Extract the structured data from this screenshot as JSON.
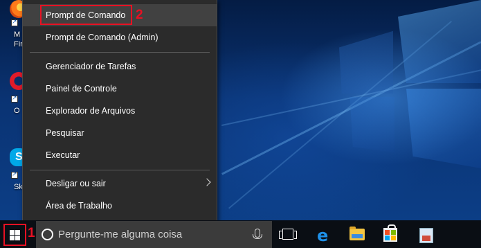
{
  "desktop": {
    "icons": [
      {
        "name": "firefox",
        "label_line1": "M",
        "label_line2": "Fir"
      },
      {
        "name": "opera",
        "label_line1": "O"
      },
      {
        "name": "skype",
        "label_line1": "Sk"
      }
    ]
  },
  "context_menu": {
    "items": [
      {
        "label": "Prompt de Comando"
      },
      {
        "label": "Prompt de Comando (Admin)"
      },
      {
        "label": "Gerenciador de Tarefas"
      },
      {
        "label": "Painel de Controle"
      },
      {
        "label": "Explorador de Arquivos"
      },
      {
        "label": "Pesquisar"
      },
      {
        "label": "Executar"
      },
      {
        "label": "Desligar ou sair"
      },
      {
        "label": "Área de Trabalho"
      }
    ],
    "highlighted_item": "Prompt de Comando"
  },
  "annotations": {
    "step1": "1",
    "step2": "2",
    "color": "#e81123"
  },
  "taskbar": {
    "search_placeholder": "Pergunte-me alguma coisa",
    "pinned_apps": [
      "task-view",
      "edge",
      "file-explorer",
      "store",
      "app"
    ]
  },
  "colors": {
    "menu_bg": "#2b2b2b",
    "taskbar_bg": "#0a0e14",
    "search_bg": "#3b3b3b"
  }
}
